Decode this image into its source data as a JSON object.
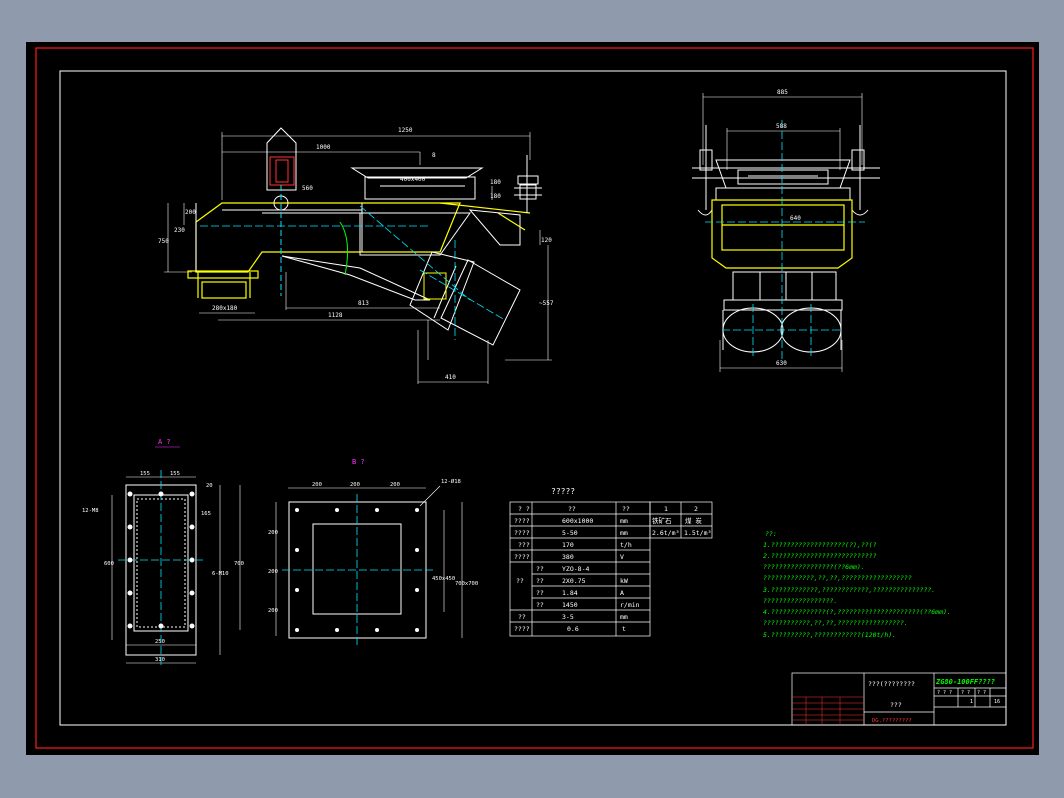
{
  "colors": {
    "background": "#8f9aac",
    "paper": "#000000",
    "frame_red": "#ff1a1a",
    "outline_white": "#ffffff",
    "yellow": "#ffff00",
    "cyan": "#00e5ff",
    "green": "#00ff00",
    "red_text": "#ff3333",
    "magenta": "#ff33ff"
  },
  "views": {
    "section_a_label": "A ?",
    "section_b_label": "B ?"
  },
  "dims": {
    "d1250": "1250",
    "d1000": "1000",
    "d400": "400x400",
    "d2": "8",
    "d180a": "180",
    "d180b": "180",
    "d120": "120",
    "d200": "200",
    "d230": "230",
    "d750": "750",
    "d560": "560",
    "d813": "813",
    "d1128": "1128",
    "d557": "~557",
    "d410": "410",
    "d280": "280x180",
    "d885": "885",
    "d588": "588",
    "d640": "640",
    "d630": "630",
    "a155a": "155",
    "a155b": "155",
    "a20": "20",
    "a165": "165",
    "a600": "600",
    "a700": "700",
    "a6x10": "6-M10",
    "a250": "250",
    "a310": "310",
    "ahole": "12-M8",
    "b200a": "200",
    "b200b": "200",
    "b200c": "200",
    "b12": "12-Ø18",
    "b200d": "200",
    "b200e": "200",
    "b200f": "200",
    "b450": "450x450",
    "b700": "700x700"
  },
  "table": {
    "title": "?????",
    "header": [
      "? ?",
      "??",
      "??",
      "1",
      "2"
    ],
    "rows": [
      [
        "????",
        "600x1000",
        "mm"
      ],
      [
        "????",
        "5-50",
        "mm"
      ],
      [
        "???",
        "170",
        "t/h"
      ],
      [
        "????",
        "380",
        "V"
      ],
      [
        "??",
        "YZO-8-4",
        ""
      ],
      [
        "",
        "2X0.75",
        "kW"
      ],
      [
        "",
        "1.84",
        "A"
      ],
      [
        "",
        "1450",
        "r/min"
      ],
      [
        "??",
        "3-5",
        "mm"
      ],
      [
        "????",
        "0.6",
        "t"
      ]
    ],
    "right_col1": [
      "铁矿石",
      "2.6t/m³"
    ],
    "right_col2": [
      "煤 炭",
      "1.5t/m³"
    ]
  },
  "notes": {
    "heading": "??:",
    "lines": [
      "1.???????????????????(?),??(?",
      "2.???????????????????????????",
      "  ??????????????????(??6mm).",
      "  ?????????????,??,??,??????????????????",
      "3.????????????,????????????,???????????????.",
      "  ??????????????????.",
      "4.??????????????(?,?????????????????????(??6mm).",
      "  ????????????,??,??,?????????????????.",
      "5.??????????,????????????(120t/h)."
    ]
  },
  "title_block": {
    "product": "ZG80-100FF????",
    "desc1": "???(????????",
    "desc2": "???",
    "company": "DG.?????????",
    "small": [
      "? ? ?",
      "? ?",
      "? ?",
      "1",
      "16"
    ]
  }
}
